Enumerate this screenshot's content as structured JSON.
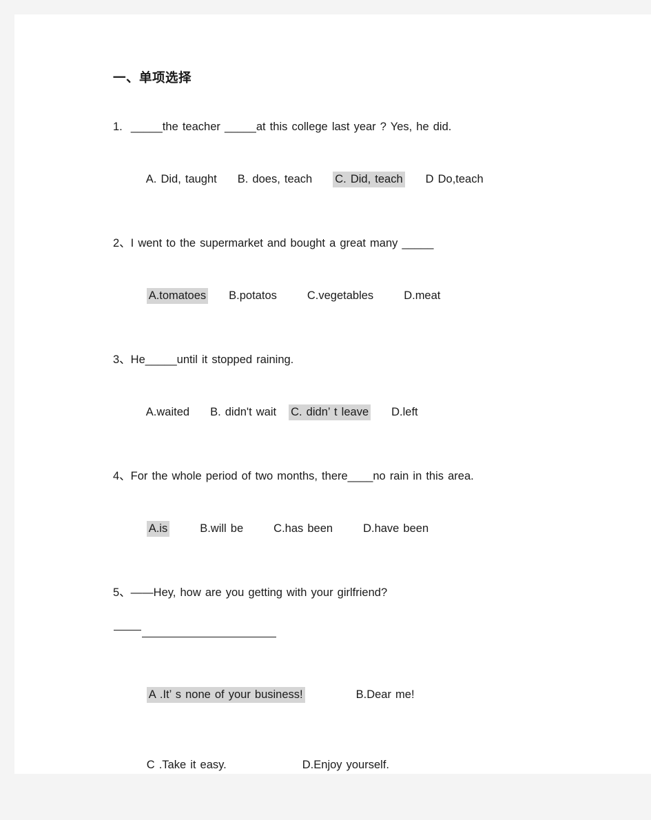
{
  "document": {
    "section_title": "一、单项选择",
    "background_color": "#f4f4f4",
    "page_color": "#ffffff",
    "text_color": "#1a1a1a",
    "highlight_color": "#d5d5d5"
  },
  "questions": [
    {
      "number": "1.",
      "stem": "1.  _____the teacher _____at this college last year ? Yes, he did.",
      "options": [
        {
          "label": "A. Did, taught",
          "highlighted": false
        },
        {
          "label": "B. does, teach",
          "highlighted": false
        },
        {
          "label": "C. Did, teach",
          "highlighted": true
        },
        {
          "label": "D Do,teach",
          "highlighted": false
        }
      ]
    },
    {
      "number": "2、",
      "stem": "2、I went to the supermarket and bought a great many _____",
      "options": [
        {
          "label": "A.tomatoes",
          "highlighted": true
        },
        {
          "label": "B.potatos",
          "highlighted": false
        },
        {
          "label": "C.vegetables",
          "highlighted": false
        },
        {
          "label": "D.meat",
          "highlighted": false
        }
      ]
    },
    {
      "number": "3、",
      "stem": "3、He_____until it stopped raining.",
      "options": [
        {
          "label": "A.waited",
          "highlighted": false
        },
        {
          "label": "B. didn't wait",
          "highlighted": false
        },
        {
          "label": "C. didn’ t leave",
          "highlighted": true
        },
        {
          "label": "D.left",
          "highlighted": false
        }
      ]
    },
    {
      "number": "4、",
      "stem": "4、For the whole period of two months, there____no rain in this area.",
      "options": [
        {
          "label": "A.is",
          "highlighted": true
        },
        {
          "label": "B.will be",
          "highlighted": false
        },
        {
          "label": "C.has been",
          "highlighted": false
        },
        {
          "label": "D.have been",
          "highlighted": false
        }
      ]
    },
    {
      "number": "5、",
      "stem": "5、——Hey, how are you getting with your girlfriend?",
      "answer_blank": true,
      "options": [
        {
          "label": "A .It’ s none of your business!",
          "highlighted": true
        },
        {
          "label": "B.Dear me!",
          "highlighted": false
        },
        {
          "label": "C .Take it easy.",
          "highlighted": false
        },
        {
          "label": "D.Enjoy yourself.",
          "highlighted": false
        }
      ]
    }
  ]
}
